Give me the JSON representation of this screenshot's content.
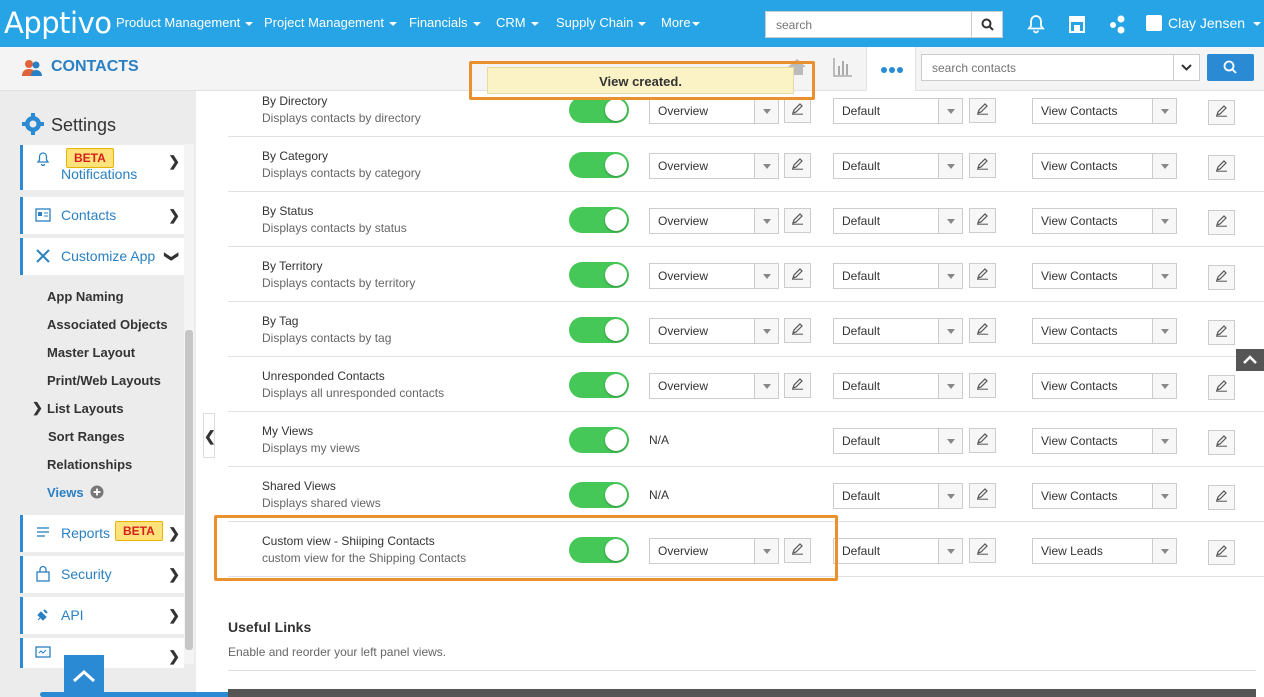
{
  "app": {
    "logo": "Apptivo"
  },
  "topnav": {
    "items": [
      "Product Management",
      "Project Management",
      "Financials",
      "CRM",
      "Supply Chain",
      "More"
    ],
    "search_placeholder": "search",
    "user_name": "Clay Jensen"
  },
  "subbar": {
    "title": "CONTACTS",
    "search_placeholder": "search contacts",
    "toast": "View created."
  },
  "sidebar": {
    "heading": "Settings",
    "menus": {
      "notifications": "Notifications",
      "contacts": "Contacts",
      "customize_app": "Customize App",
      "reports": "Reports",
      "security": "Security",
      "api": "API"
    },
    "beta_label": "BETA",
    "submenu": [
      "App Naming",
      "Associated Objects",
      "Master Layout",
      "Print/Web Layouts",
      "List Layouts",
      "Sort Ranges",
      "Relationships",
      "Views"
    ]
  },
  "views": [
    {
      "title": "By Directory",
      "desc": "Displays contacts by directory",
      "enabled": true,
      "layout": "Overview",
      "sort": "Default",
      "target": "View Contacts"
    },
    {
      "title": "By Category",
      "desc": "Displays contacts by category",
      "enabled": true,
      "layout": "Overview",
      "sort": "Default",
      "target": "View Contacts"
    },
    {
      "title": "By Status",
      "desc": "Displays contacts by status",
      "enabled": true,
      "layout": "Overview",
      "sort": "Default",
      "target": "View Contacts"
    },
    {
      "title": "By Territory",
      "desc": "Displays contacts by territory",
      "enabled": true,
      "layout": "Overview",
      "sort": "Default",
      "target": "View Contacts"
    },
    {
      "title": "By Tag",
      "desc": "Displays contacts by tag",
      "enabled": true,
      "layout": "Overview",
      "sort": "Default",
      "target": "View Contacts"
    },
    {
      "title": "Unresponded Contacts",
      "desc": "Displays all unresponded contacts",
      "enabled": true,
      "layout": "Overview",
      "sort": "Default",
      "target": "View Contacts"
    },
    {
      "title": "My Views",
      "desc": "Displays my views",
      "enabled": true,
      "layout": "N/A",
      "sort": "Default",
      "target": "View Contacts"
    },
    {
      "title": "Shared Views",
      "desc": "Displays shared views",
      "enabled": true,
      "layout": "N/A",
      "sort": "Default",
      "target": "View Contacts"
    },
    {
      "title": "Custom view - Shiiping Contacts",
      "desc": "custom view for the Shipping Contacts",
      "enabled": true,
      "layout": "Overview",
      "sort": "Default",
      "target": "View Leads"
    }
  ],
  "useful_links": {
    "heading": "Useful Links",
    "desc": "Enable and reorder your left panel views."
  },
  "colors": {
    "brand": "#27a4e6",
    "accent": "#2a8ad4",
    "highlight": "#e8912d",
    "toggle_on": "#45c857"
  }
}
